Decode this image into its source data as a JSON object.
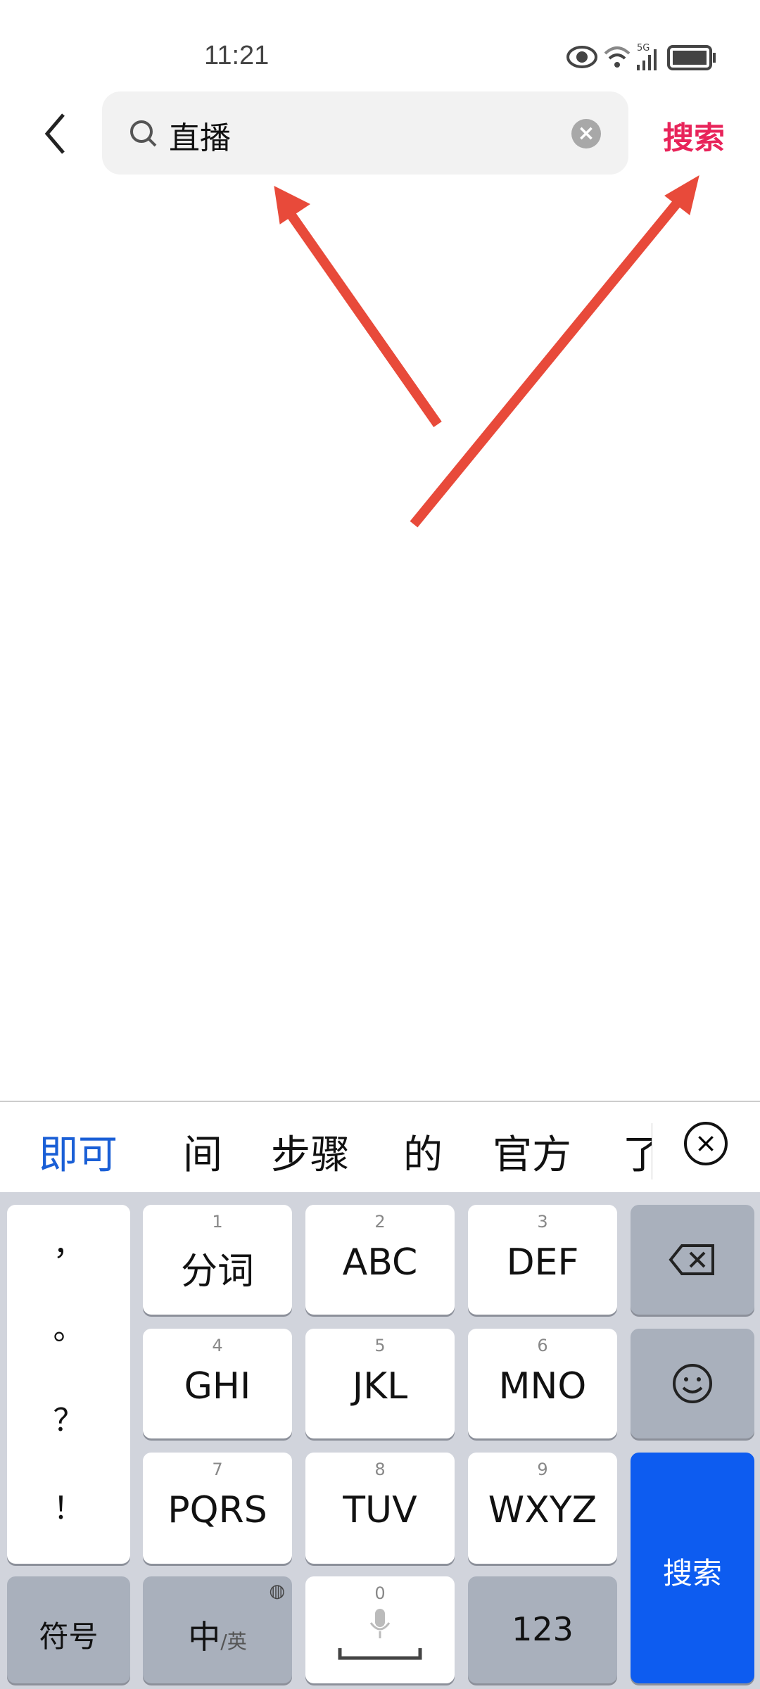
{
  "status_bar": {
    "time": "11:21",
    "network": "5G",
    "icons": [
      "eye-icon",
      "wifi-icon",
      "signal-icon",
      "battery-icon"
    ]
  },
  "header": {
    "search_value": "直播",
    "search_button": "搜索"
  },
  "colors": {
    "accent": "#e8245a",
    "arrow": "#e84a3a",
    "keyboard_bg": "#d1d4dc",
    "key_blue": "#0d5cf0",
    "candidate_highlight": "#1a5fd6"
  },
  "candidates": [
    "即可",
    "间",
    "步骤",
    "的",
    "官方",
    "了"
  ],
  "keyboard": {
    "punct": [
      "，",
      "。",
      "？",
      "！"
    ],
    "keys": [
      {
        "num": "1",
        "label": "分词"
      },
      {
        "num": "2",
        "label": "ABC"
      },
      {
        "num": "3",
        "label": "DEF"
      },
      {
        "num": "4",
        "label": "GHI"
      },
      {
        "num": "5",
        "label": "JKL"
      },
      {
        "num": "6",
        "label": "MNO"
      },
      {
        "num": "7",
        "label": "PQRS"
      },
      {
        "num": "8",
        "label": "TUV"
      },
      {
        "num": "9",
        "label": "WXYZ"
      }
    ],
    "symbols": "符号",
    "lang_main": "中",
    "lang_alt": "/英",
    "space_num": "0",
    "numbers": "123",
    "search": "搜索"
  }
}
